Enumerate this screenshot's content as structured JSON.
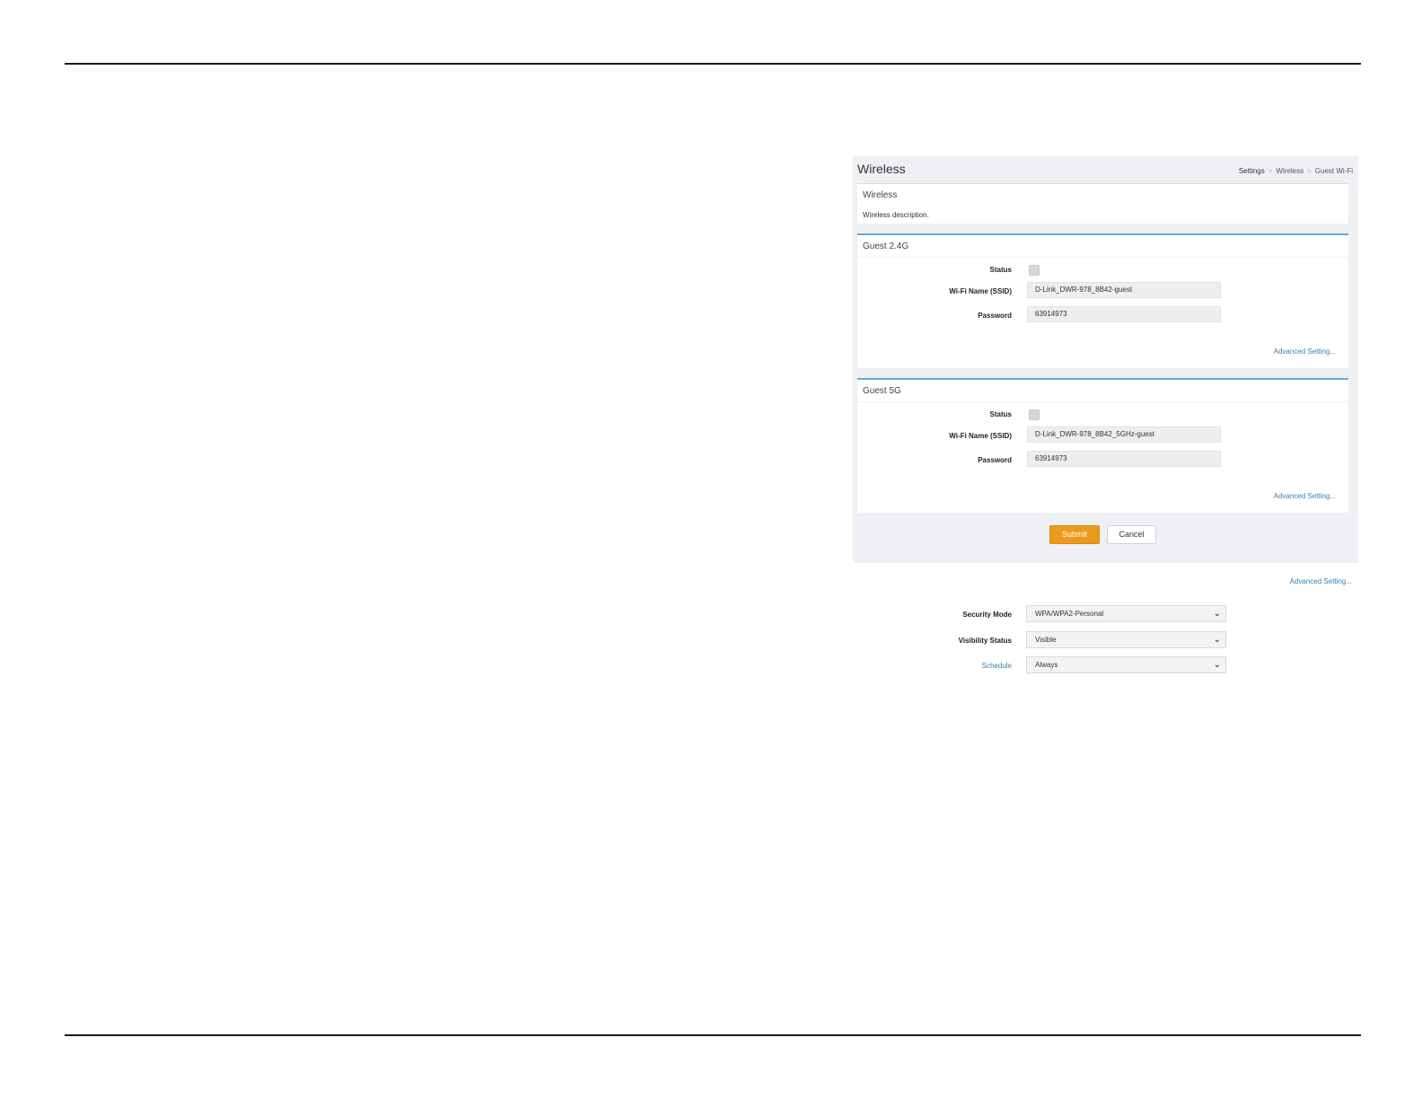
{
  "page": {
    "title": "Wireless",
    "breadcrumb": [
      "Settings",
      "Wireless",
      "Guest Wi-Fi"
    ]
  },
  "info_panel": {
    "title": "Wireless",
    "description": "Wireless description."
  },
  "guest_24g": {
    "title": "Guest 2.4G",
    "status_label": "Status",
    "ssid_label": "Wi-Fi Name (SSID)",
    "ssid_value": "D-Link_DWR-978_8B42-guest",
    "password_label": "Password",
    "password_value": "63914973",
    "advanced_link": "Advanced Setting..."
  },
  "guest_5g": {
    "title": "Guest 5G",
    "status_label": "Status",
    "ssid_label": "Wi-Fi Name (SSID)",
    "ssid_value": "D-Link_DWR-978_8B42_5GHz-guest",
    "password_label": "Password",
    "password_value": "63914973",
    "advanced_link": "Advanced Setting..."
  },
  "actions": {
    "submit_label": "Submit",
    "cancel_label": "Cancel"
  },
  "advanced": {
    "link": "Advanced Setting...",
    "security_mode_label": "Security Mode",
    "security_mode_value": "WPA/WPA2-Personal",
    "visibility_label": "Visibility Status",
    "visibility_value": "Visible",
    "schedule_label": "Schedule",
    "schedule_value": "Always"
  },
  "colors": {
    "accent_blue": "#5aaee0",
    "link_blue": "#3d7fb0",
    "submit_orange": "#ea9b1e"
  }
}
